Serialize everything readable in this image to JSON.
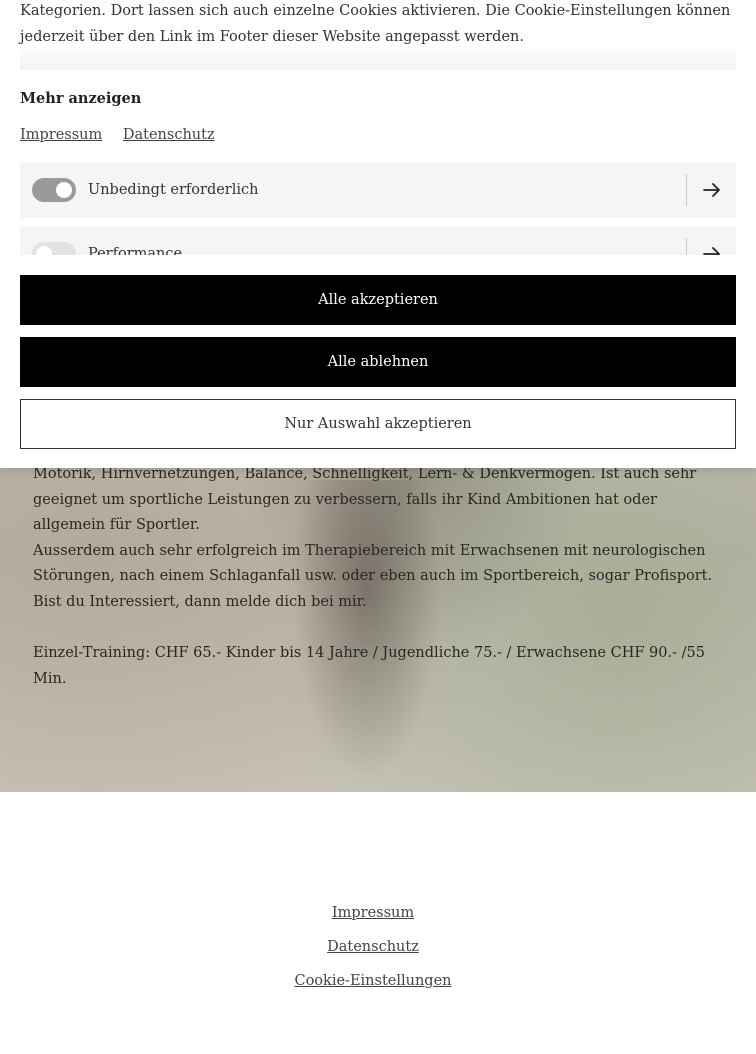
{
  "cookie_banner": {
    "intro_text": "Kategorien. Dort lassen sich auch einzelne Cookies aktivieren. Die Cookie-Einstellungen können jederzeit über den Link im Footer dieser Website angepasst werden.",
    "more_label": "Mehr anzeigen",
    "legal_links": [
      "Impressum",
      "Datenschutz"
    ],
    "categories": [
      {
        "label": "Unbedingt erforderlich",
        "enabled": true
      },
      {
        "label": "Performance",
        "enabled": false
      }
    ],
    "buttons": {
      "accept_all": "Alle akzeptieren",
      "reject_all": "Alle ablehnen",
      "accept_selection": "Nur Auswahl akzeptieren"
    },
    "arrow_icon": "arrow-right-icon"
  },
  "hero": {
    "paragraphs": [
      "Motorik, Hirnvernetzungen, Balance, Schnelligkeit, Lern- & Denkvermögen. Ist auch sehr geeignet um sportliche Leistungen zu verbessern, falls ihr Kind Ambitionen hat oder allgemein für Sportler.",
      "Ausserdem auch sehr erfolgreich im Therapiebereich mit Erwachsenen mit neurologischen Störungen, nach einem Schlaganfall usw. oder eben auch im Sportbereich, sogar Profisport.",
      "Bist du Interessiert, dann melde dich bei mir."
    ],
    "pricing": "Einzel-Training: CHF 65.- Kinder bis 14 Jahre / Jugendliche 75.- / Erwachsene CHF 90.- /55 Min."
  },
  "footer": {
    "links": [
      "Impressum",
      "Datenschutz",
      "Cookie-Einstellungen"
    ]
  },
  "colors": {
    "button_dark": "#000000",
    "toggle_on": "#9a9a9a",
    "toggle_off": "#e2e2e2",
    "category_bg": "#f5f5f5"
  }
}
